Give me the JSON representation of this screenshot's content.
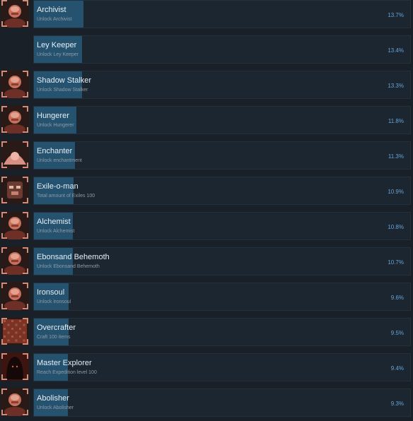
{
  "achievements": [
    {
      "title": "Archivist",
      "description": "Unlock Archivist",
      "percent": "13.7%",
      "percent_value": 13.7,
      "icon": "archivist-portrait-icon",
      "has_icon": true
    },
    {
      "title": "Ley Keeper",
      "description": "Unlock Ley Keeper",
      "percent": "13.4%",
      "percent_value": 13.4,
      "icon": "ley-keeper-icon",
      "has_icon": false
    },
    {
      "title": "Shadow Stalker",
      "description": "Unlock Shadow Stalker",
      "percent": "13.3%",
      "percent_value": 13.3,
      "icon": "shadow-stalker-portrait-icon",
      "has_icon": true
    },
    {
      "title": "Hungerer",
      "description": "Unlock Hungerer",
      "percent": "11.8%",
      "percent_value": 11.8,
      "icon": "hungerer-portrait-icon",
      "has_icon": true
    },
    {
      "title": "Enchanter",
      "description": "Unlock enchantment",
      "percent": "11.3%",
      "percent_value": 11.3,
      "icon": "enchanter-dust-icon",
      "has_icon": true
    },
    {
      "title": "Exile-o-man",
      "description": "Total amount of Exiles 100",
      "percent": "10.9%",
      "percent_value": 10.9,
      "icon": "exile-mask-icon",
      "has_icon": true
    },
    {
      "title": "Alchemist",
      "description": "Unlock Alchemist",
      "percent": "10.8%",
      "percent_value": 10.8,
      "icon": "alchemist-portrait-icon",
      "has_icon": true
    },
    {
      "title": "Ebonsand Behemoth",
      "description": "Unlock Ebonsand Behemoth",
      "percent": "10.7%",
      "percent_value": 10.7,
      "icon": "behemoth-portrait-icon",
      "has_icon": true
    },
    {
      "title": "Ironsoul",
      "description": "Unlock Ironsoul",
      "percent": "9.6%",
      "percent_value": 9.6,
      "icon": "ironsoul-portrait-icon",
      "has_icon": true
    },
    {
      "title": "Overcrafter",
      "description": "Craft 100 items",
      "percent": "9.5%",
      "percent_value": 9.5,
      "icon": "overcrafter-texture-icon",
      "has_icon": true
    },
    {
      "title": "Master Explorer",
      "description": "Reach Expedition level 100",
      "percent": "9.4%",
      "percent_value": 9.4,
      "icon": "hooded-explorer-icon",
      "has_icon": true
    },
    {
      "title": "Abolisher",
      "description": "Unlock Abolisher",
      "percent": "9.3%",
      "percent_value": 9.3,
      "icon": "abolisher-portrait-icon",
      "has_icon": true
    }
  ],
  "colors": {
    "background": "#1a2028",
    "row_panel": "#1b2631",
    "progress_fill": "#25536f",
    "percent_text": "#69a3d4",
    "icon_frame": "#d08b7a"
  }
}
